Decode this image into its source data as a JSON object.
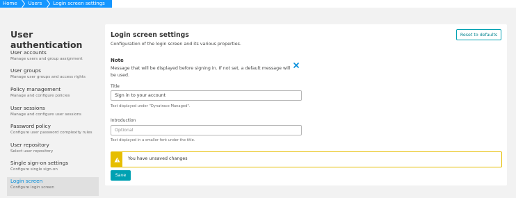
{
  "breadcrumb": {
    "items": [
      {
        "label": "Home"
      },
      {
        "label": "Users"
      },
      {
        "label": "Login screen settings"
      }
    ]
  },
  "sidebar": {
    "title": "User authentication",
    "items": [
      {
        "label": "User accounts",
        "sub": "Manage users and group assignment"
      },
      {
        "label": "User groups",
        "sub": "Manage user groups and access rights"
      },
      {
        "label": "Policy management",
        "sub": "Manage and configure policies"
      },
      {
        "label": "User sessions",
        "sub": "Manage and configure user sessions"
      },
      {
        "label": "Password policy",
        "sub": "Configure user password complexity rules"
      },
      {
        "label": "User repository",
        "sub": "Select user repository"
      },
      {
        "label": "Single sign-on settings",
        "sub": "Configure single sign-on"
      },
      {
        "label": "Login screen",
        "sub": "Configure login screen",
        "active": true
      }
    ]
  },
  "main": {
    "title": "Login screen settings",
    "description": "Configuration of the login screen and its various properties.",
    "reset_label": "Reset to defaults",
    "note": {
      "title": "Note",
      "text": "Message that will be displayed before signing in. If not set, a default message will be used."
    },
    "title_field": {
      "label": "Title",
      "value": "Sign in to your account",
      "help": "Text displayed under \"Dynatrace Managed\"."
    },
    "intro_field": {
      "label": "Introduction",
      "placeholder": "Optional",
      "help": "Text displayed in a smaller font under the title."
    },
    "warning": {
      "text": "You have unsaved changes",
      "icon": "warning-triangle-icon"
    },
    "save_label": "Save"
  },
  "colors": {
    "breadcrumb": "#1496ff",
    "accent": "#00a1b2",
    "warning": "#e6be00",
    "active_link": "#008cdb"
  }
}
